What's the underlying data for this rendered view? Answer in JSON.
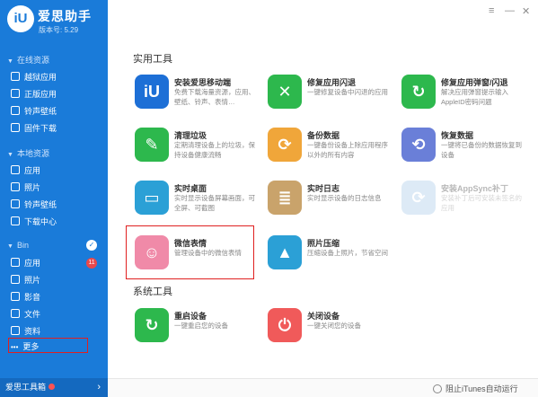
{
  "app": {
    "logo_text": "iU",
    "title": "爱思助手",
    "version": "版本号: 5.29"
  },
  "window": {
    "menu_icon": "≡",
    "minimize": "—",
    "close": "✕"
  },
  "sidebar": {
    "sections": [
      {
        "label": "在线资源",
        "items": [
          "越狱应用",
          "正版应用",
          "铃声壁纸",
          "固件下载"
        ]
      },
      {
        "label": "本地资源",
        "items": [
          "应用",
          "照片",
          "铃声壁纸",
          "下载中心"
        ]
      },
      {
        "label": "Bin",
        "items": [
          "应用",
          "照片",
          "影音",
          "文件",
          "资料",
          "更多"
        ]
      }
    ],
    "badge_count": "11",
    "more_dots": "•••",
    "footer": {
      "label": "爱思工具箱"
    }
  },
  "main": {
    "section_utilities": "实用工具",
    "section_system": "系统工具",
    "cards": [
      {
        "name": "安装爱思移动端",
        "desc": "免费下载海量资源，应用、壁纸、铃声、表情…",
        "color": "#1d6fd6",
        "glyph": "iU"
      },
      {
        "name": "修复应用闪退",
        "desc": "一键修复设备中闪退的应用",
        "color": "#2db84d",
        "glyph": "✕"
      },
      {
        "name": "修复应用弹窗/闪退",
        "desc": "解决应用弹窗提示输入AppleID密码问题",
        "color": "#2db84d",
        "glyph": "↻"
      },
      {
        "name": "清理垃圾",
        "desc": "定期清理设备上的垃圾，保持设备健康流畅",
        "color": "#2db84d",
        "glyph": "✎"
      },
      {
        "name": "备份数据",
        "desc": "一键备份设备上除应用程序以外的所有内容",
        "color": "#f0a63a",
        "glyph": "⟳"
      },
      {
        "name": "恢复数据",
        "desc": "一键将已备份的数据恢复到设备",
        "color": "#6a7fd8",
        "glyph": "⟲"
      },
      {
        "name": "实时桌面",
        "desc": "实时显示设备屏幕画面，可全屏、可截图",
        "color": "#2ba0d6",
        "glyph": "▭"
      },
      {
        "name": "实时日志",
        "desc": "实时显示设备的日志信息",
        "color": "#c9a36b",
        "glyph": "≣"
      },
      {
        "name": "安装AppSync补丁",
        "desc": "安装补丁后可安装未签名的应用",
        "color": "#9fc4e8",
        "glyph": "⟳"
      },
      {
        "name": "微信表情",
        "desc": "管理设备中的微信表情",
        "color": "#f08aa8",
        "glyph": "☺"
      },
      {
        "name": "照片压缩",
        "desc": "压缩设备上照片，节省空间",
        "color": "#2ba0d6",
        "glyph": "▲"
      }
    ],
    "system_cards": [
      {
        "name": "重启设备",
        "desc": "一键重启您的设备",
        "color": "#2db84d",
        "glyph": "↻"
      },
      {
        "name": "关闭设备",
        "desc": "一键关闭您的设备",
        "color": "#f05a5a",
        "glyph": "⏻"
      }
    ]
  },
  "bottom": {
    "itunes_label": "阻止iTunes自动运行"
  }
}
